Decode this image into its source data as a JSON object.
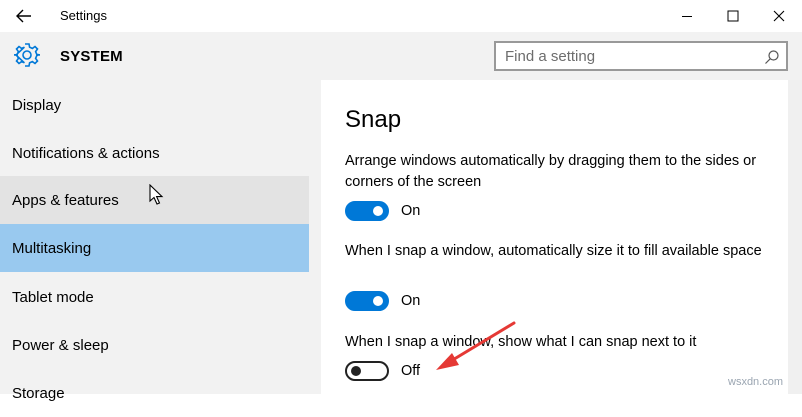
{
  "window": {
    "title": "Settings"
  },
  "header": {
    "section": "SYSTEM",
    "search_placeholder": "Find a setting"
  },
  "sidebar": {
    "items": [
      {
        "label": "Display"
      },
      {
        "label": "Notifications & actions"
      },
      {
        "label": "Apps & features"
      },
      {
        "label": "Multitasking"
      },
      {
        "label": "Tablet mode"
      },
      {
        "label": "Power & sleep"
      },
      {
        "label": "Storage"
      }
    ]
  },
  "main": {
    "title": "Snap",
    "settings": [
      {
        "description": "Arrange windows automatically by dragging them to the sides or corners of the screen",
        "state": "On"
      },
      {
        "description": "When I snap a window, automatically size it to fill available space",
        "state": "On"
      },
      {
        "description": "When I snap a window, show what I can snap next to it",
        "state": "Off"
      }
    ]
  },
  "colors": {
    "accent": "#0078d7",
    "selected": "#99c9ef",
    "annotation_arrow": "#e53935"
  },
  "watermark": "wsxdn.com"
}
